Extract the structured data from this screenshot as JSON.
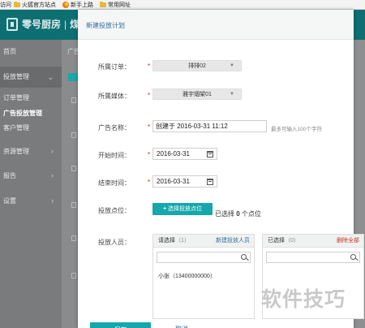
{
  "bookmarks": {
    "items": [
      {
        "label": "访问",
        "icon": "none"
      },
      {
        "label": "火狐官方站点",
        "icon": "folder-icon"
      },
      {
        "label": "新手上路",
        "icon": "firefox-icon"
      },
      {
        "label": "常用网址",
        "icon": "folder-icon"
      }
    ]
  },
  "header": {
    "brand": "零号厨房",
    "brand_suffix": "煤"
  },
  "sidebar": {
    "items": [
      {
        "label": "首页"
      },
      {
        "label": "投放管理"
      },
      {
        "label": "订单管理"
      },
      {
        "label": "广告投放管理"
      },
      {
        "label": "客户管理"
      },
      {
        "label": "资源管理"
      },
      {
        "label": "报告"
      },
      {
        "label": "设置"
      }
    ]
  },
  "background": {
    "tab_label": "广告"
  },
  "modal": {
    "title": "新建投放计划",
    "fields": {
      "order": {
        "label": "所属订单：",
        "value": "排排02"
      },
      "media": {
        "label": "所属媒体：",
        "value": "雅宇烟架01"
      },
      "ad_name": {
        "label": "广告名称：",
        "value": "创建于 2016-03-31 11:12",
        "hint": "最多可输入100个字符"
      },
      "start_time": {
        "label": "开始时间：",
        "value": "2016-03-31"
      },
      "end_time": {
        "label": "结束时间：",
        "value": "2016-03-31"
      },
      "slots": {
        "label": "投放点位：",
        "button": "选择投放点位",
        "selected_prefix": "已选择",
        "selected_count": "0",
        "selected_suffix": "个点位"
      },
      "people": {
        "label": "投放人员："
      }
    },
    "required_mark": "*",
    "left_panel": {
      "title": "请选择",
      "count": "（1）",
      "link": "新建投放人员",
      "items": [
        "小张（13400000000）"
      ]
    },
    "right_panel": {
      "title": "已选择",
      "count": "（0）",
      "link": "删除全部"
    },
    "ok_label": "保存",
    "cancel_label": "取消"
  },
  "watermark": "软件技巧",
  "colors": {
    "header_bg": "#0e6f72",
    "accent": "#14a8ab",
    "required": "#d9261c",
    "link": "#2f6f9a"
  }
}
